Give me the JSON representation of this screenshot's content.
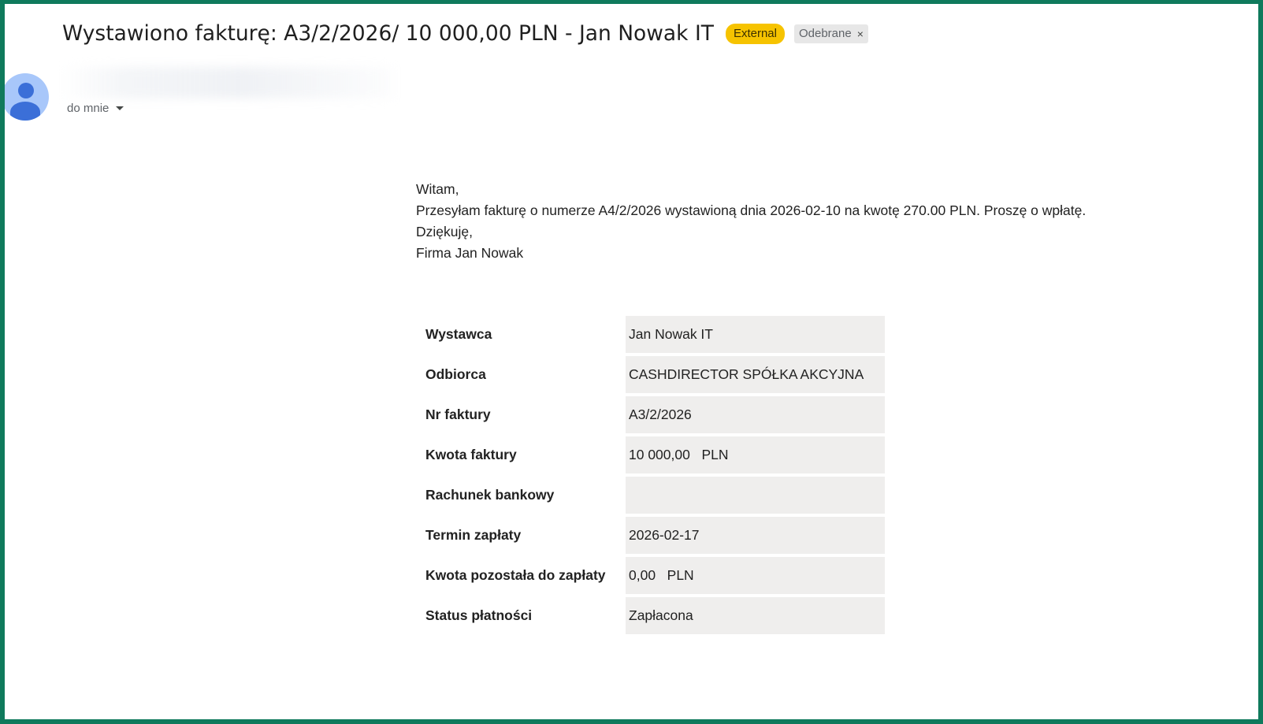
{
  "email": {
    "subject": "Wystawiono fakturę: A3/2/2026/ 10 000,00 PLN - Jan Nowak IT",
    "badges": {
      "external": "External",
      "label": "Odebrane",
      "label_remove": "×"
    },
    "recipient": "do mnie",
    "body_lines": [
      "Witam,",
      "Przesyłam fakturę o numerze A4/2/2026 wystawioną dnia 2026-02-10 na kwotę 270.00 PLN. Proszę o wpłatę.",
      "Dziękuję,",
      "Firma Jan Nowak"
    ],
    "invoice": {
      "rows": [
        {
          "label": "Wystawca",
          "value": "Jan Nowak IT"
        },
        {
          "label": "Odbiorca",
          "value": "CASHDIRECTOR SPÓŁKA AKCYJNA"
        },
        {
          "label": "Nr faktury",
          "value": "A3/2/2026"
        },
        {
          "label": "Kwota faktury",
          "value": "10 000,00   PLN"
        },
        {
          "label": "Rachunek bankowy",
          "value": ""
        },
        {
          "label": "Termin zapłaty",
          "value": "2026-02-17"
        },
        {
          "label": "Kwota pozostała do zapłaty",
          "value": "0,00   PLN"
        },
        {
          "label": "Status płatności",
          "value": "Zapłacona"
        }
      ]
    }
  },
  "colors": {
    "frame": "#0f7a5c",
    "external_badge": "#f6c300",
    "label_badge": "#e7e7e7",
    "avatar_bg": "#a8c7fa",
    "avatar_fg": "#3b6fd8",
    "table_value_bg": "#efeeed"
  },
  "icons": {
    "avatar": "person-avatar-icon",
    "recipient_caret": "caret-down-icon",
    "label_remove": "close-icon"
  }
}
